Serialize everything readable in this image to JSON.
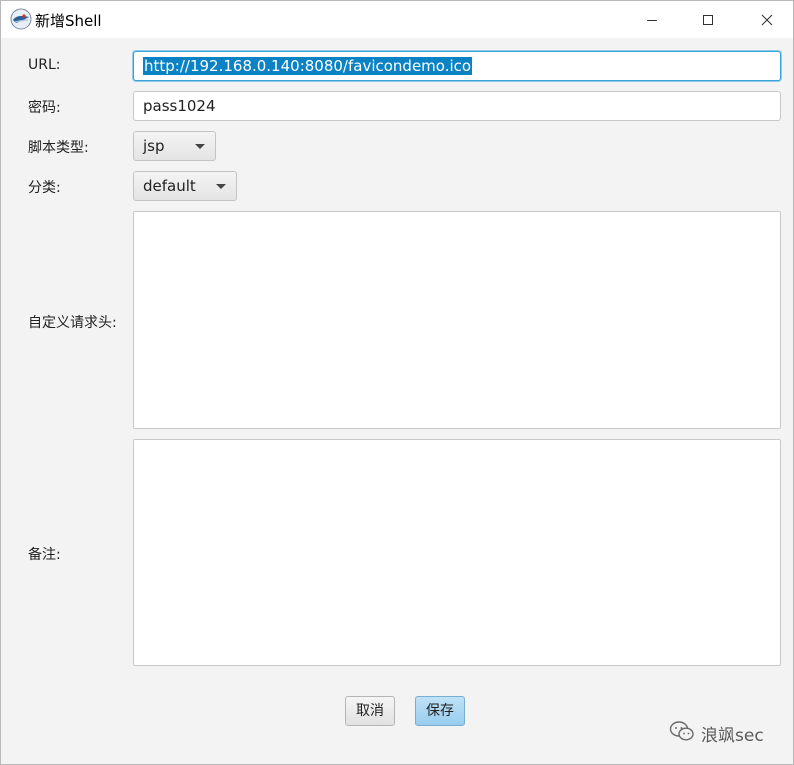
{
  "window": {
    "title": "新增Shell",
    "minimize_icon": "minimize-icon",
    "maximize_icon": "maximize-icon",
    "close_icon": "close-icon"
  },
  "form": {
    "url_label": "URL:",
    "url_value": "http://192.168.0.140:8080/favicondemo.ico",
    "password_label": "密码:",
    "password_value": "pass1024",
    "script_type_label": "脚本类型:",
    "script_type_value": "jsp",
    "category_label": "分类:",
    "category_value": "default",
    "headers_label": "自定义请求头:",
    "headers_value": "",
    "notes_label": "备注:",
    "notes_value": ""
  },
  "buttons": {
    "cancel_label": "取消",
    "save_label": "保存"
  },
  "watermark": {
    "text": "浪飒sec",
    "icon": "wechat-icon"
  },
  "colors": {
    "selection": "#0a82c4",
    "focus_border": "#3aa3d6",
    "primary_button": "#98cdee"
  }
}
